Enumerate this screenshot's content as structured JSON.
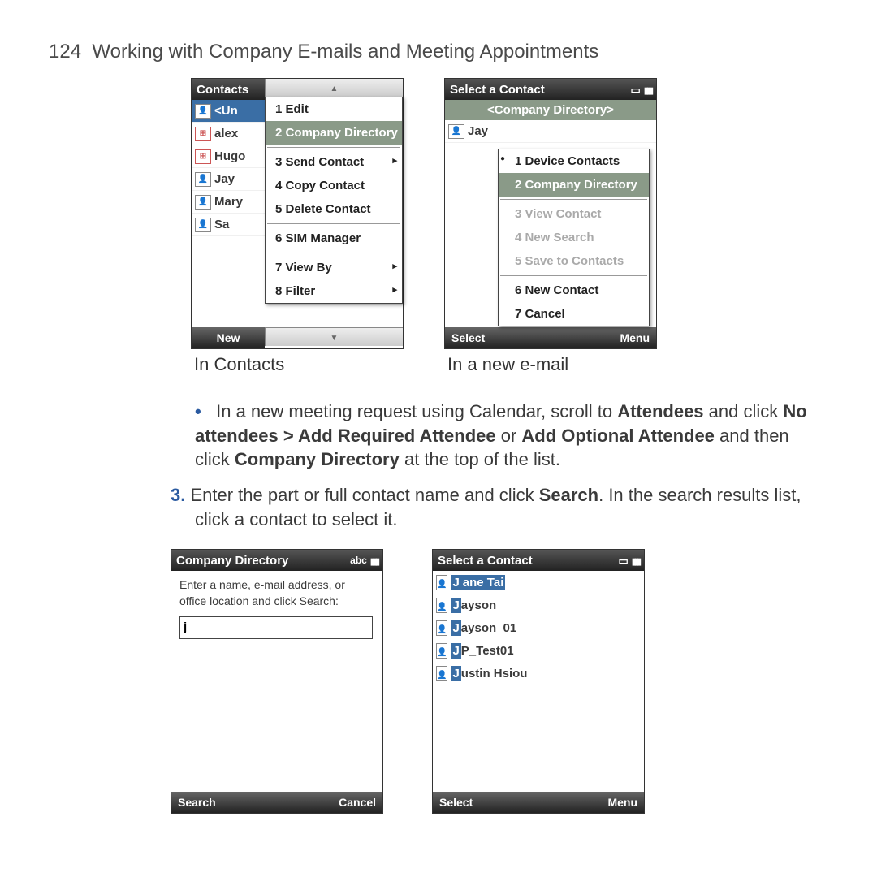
{
  "page": {
    "number": "124",
    "title": "Working with Company E-mails and Meeting Appointments"
  },
  "screenshots_top": {
    "left": {
      "caption": "In Contacts",
      "title": "Contacts",
      "softkey_left": "New",
      "contacts": [
        {
          "name": "<Un",
          "icon": "a"
        },
        {
          "name": "alex",
          "icon": "b"
        },
        {
          "name": "Hugo",
          "icon": "b"
        },
        {
          "name": "Jay",
          "icon": "a"
        },
        {
          "name": "Mary",
          "icon": "a"
        },
        {
          "name": "Sa",
          "icon": "a"
        }
      ],
      "menu": [
        {
          "label": "1 Edit"
        },
        {
          "label": "2 Company Directory",
          "hl": true
        },
        {
          "sep": true
        },
        {
          "label": "3 Send Contact",
          "arrow": true
        },
        {
          "label": "4 Copy Contact"
        },
        {
          "label": "5 Delete Contact"
        },
        {
          "sep": true
        },
        {
          "label": "6 SIM Manager"
        },
        {
          "sep": true
        },
        {
          "label": "7 View By",
          "arrow": true
        },
        {
          "label": "8 Filter",
          "arrow": true
        }
      ]
    },
    "right": {
      "caption": "In a new e-mail",
      "title": "Select a Contact",
      "header": "<Company Directory>",
      "softkey_left": "Select",
      "softkey_right": "Menu",
      "contact_shown": "Jay",
      "menu": [
        {
          "label": "1 Device Contacts",
          "radio": true
        },
        {
          "label": "2 Company Directory",
          "hl": true
        },
        {
          "sep": true
        },
        {
          "label": "3 View Contact",
          "disabled": true
        },
        {
          "label": "4 New Search",
          "disabled": true
        },
        {
          "label": "5 Save to Contacts",
          "disabled": true
        },
        {
          "sep": true
        },
        {
          "label": "6 New Contact"
        },
        {
          "label": "7 Cancel"
        }
      ]
    }
  },
  "instructions": {
    "bullet_pre": "In a new meeting request using Calendar, scroll to ",
    "bullet_bold1": "Attendees",
    "bullet_mid1": " and click ",
    "bullet_bold2": "No attendees > Add Required Attendee",
    "bullet_mid2": " or ",
    "bullet_bold3": "Add Optional Attendee",
    "bullet_mid3": " and then click ",
    "bullet_bold4": "Company Directory",
    "bullet_end": " at the top of the list.",
    "step3_num": "3.",
    "step3_a": "Enter the part or full contact name and click ",
    "step3_bold": "Search",
    "step3_b": ". In the search results list, click a contact to select it."
  },
  "screenshots_bottom": {
    "left": {
      "title": "Company Directory",
      "ime": "abc",
      "instr": "Enter a name, e-mail address, or office location and click Search:",
      "input_value": "j",
      "softkey_left": "Search",
      "softkey_right": "Cancel"
    },
    "right": {
      "title": "Select a Contact",
      "softkey_left": "Select",
      "softkey_right": "Menu",
      "results": [
        {
          "pre": "J",
          "rest": "ane Tai",
          "sel": true
        },
        {
          "pre": "J",
          "rest": "ayson"
        },
        {
          "pre": "J",
          "rest": "ayson_01"
        },
        {
          "pre": "J",
          "rest": "P_Test01"
        },
        {
          "pre": "J",
          "rest": "ustin Hsiou"
        }
      ]
    }
  }
}
